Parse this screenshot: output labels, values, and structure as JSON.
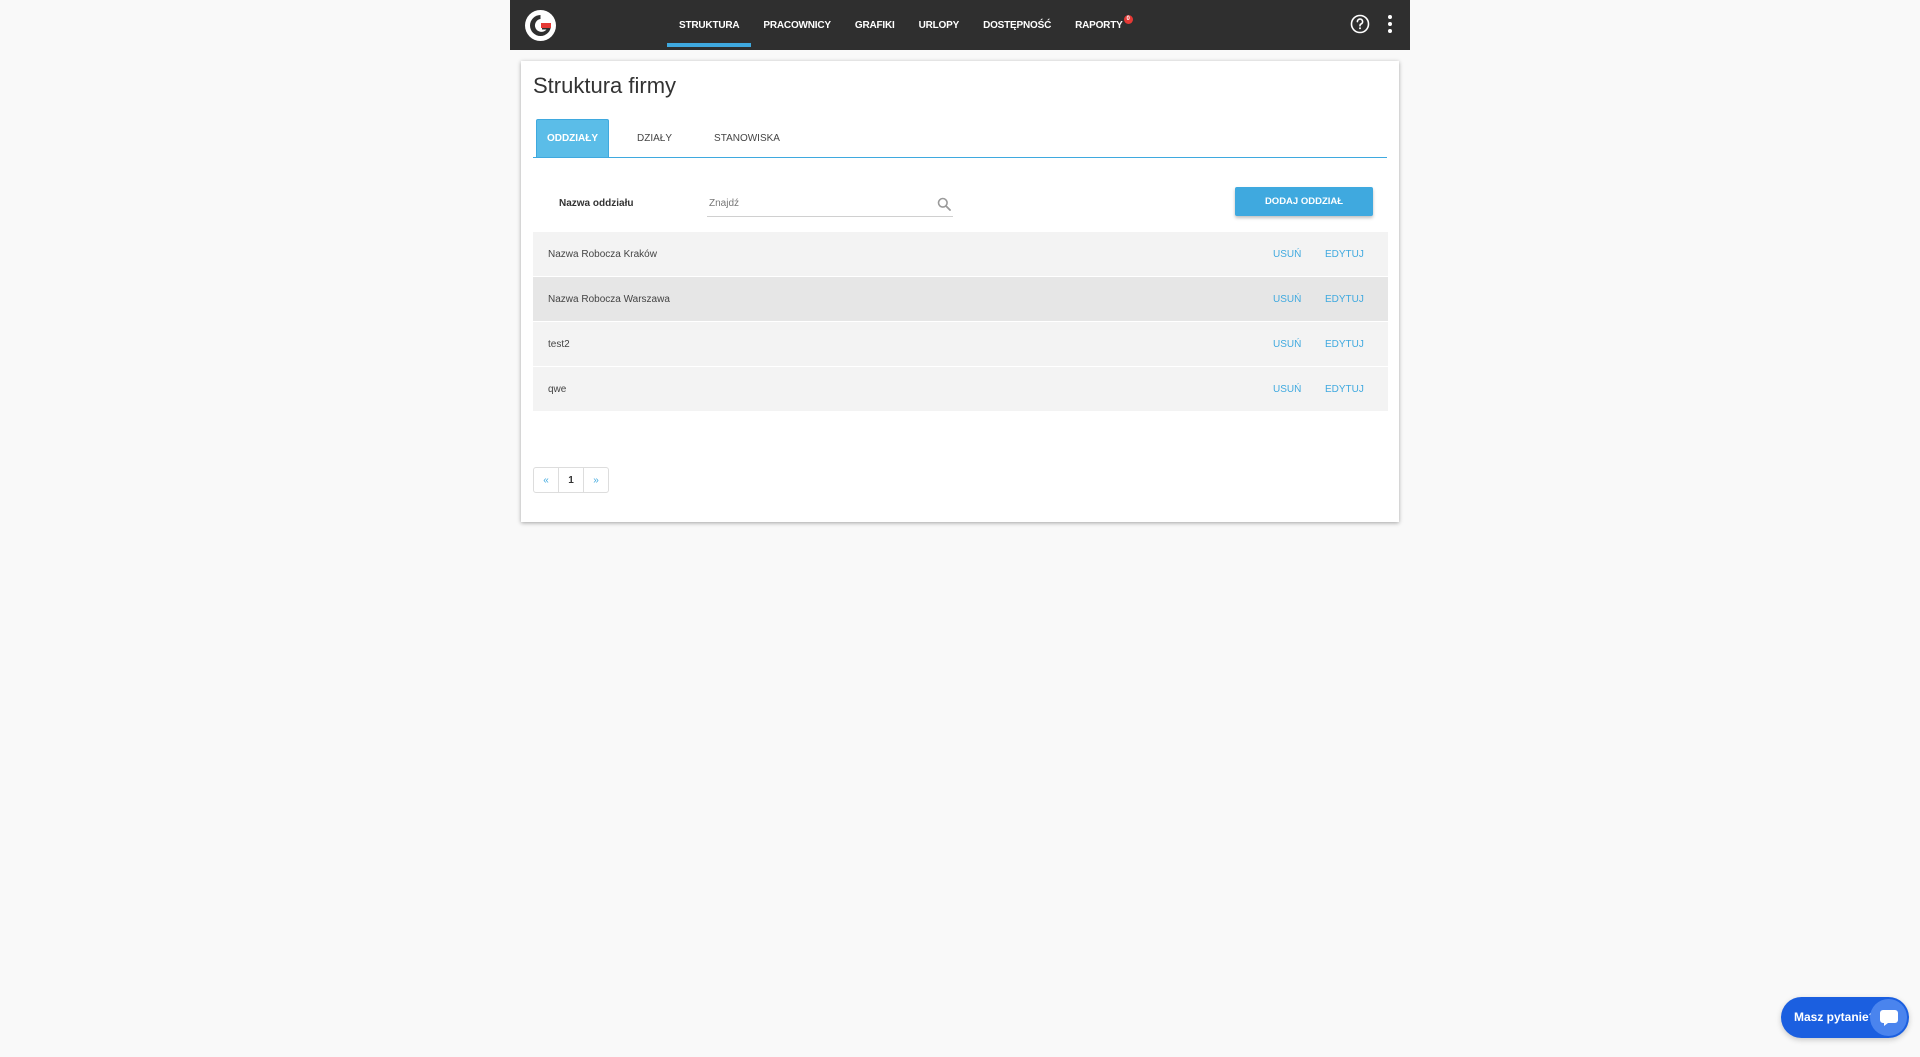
{
  "nav": {
    "items": [
      {
        "label": "STRUKTURA",
        "active": true
      },
      {
        "label": "PRACOWNICY",
        "active": false
      },
      {
        "label": "GRAFIKI",
        "active": false
      },
      {
        "label": "URLOPY",
        "active": false
      },
      {
        "label": "DOSTĘPNOŚĆ",
        "active": false
      },
      {
        "label": "RAPORTY",
        "active": false,
        "badge": "0"
      }
    ],
    "icons": {
      "logo": "g-logo-icon",
      "help": "help-circle-icon",
      "more": "more-vertical-icon"
    }
  },
  "page": {
    "title": "Struktura firmy",
    "tabs": [
      "ODDZIAŁY",
      "DZIAŁY",
      "STANOWISKA"
    ],
    "active_tab": "ODDZIAŁY"
  },
  "filter": {
    "label": "Nazwa oddziału",
    "placeholder": "Znajdź",
    "value": ""
  },
  "actions": {
    "add_label": "DODAJ ODDZIAŁ"
  },
  "rows": [
    {
      "name": "Nazwa Robocza Kraków",
      "delete": "USUŃ",
      "edit": "EDYTUJ"
    },
    {
      "name": "Nazwa Robocza Warszawa",
      "delete": "USUŃ",
      "edit": "EDYTUJ"
    },
    {
      "name": "test2",
      "delete": "USUŃ",
      "edit": "EDYTUJ"
    },
    {
      "name": "qwe",
      "delete": "USUŃ",
      "edit": "EDYTUJ"
    }
  ],
  "pagination": {
    "prev": "«",
    "current": "1",
    "next": "»"
  },
  "chat": {
    "label": "Masz pytanie?"
  },
  "colors": {
    "accent": "#3fa9df",
    "topbar": "#2f2f2f",
    "chat": "#1b5fe0"
  }
}
